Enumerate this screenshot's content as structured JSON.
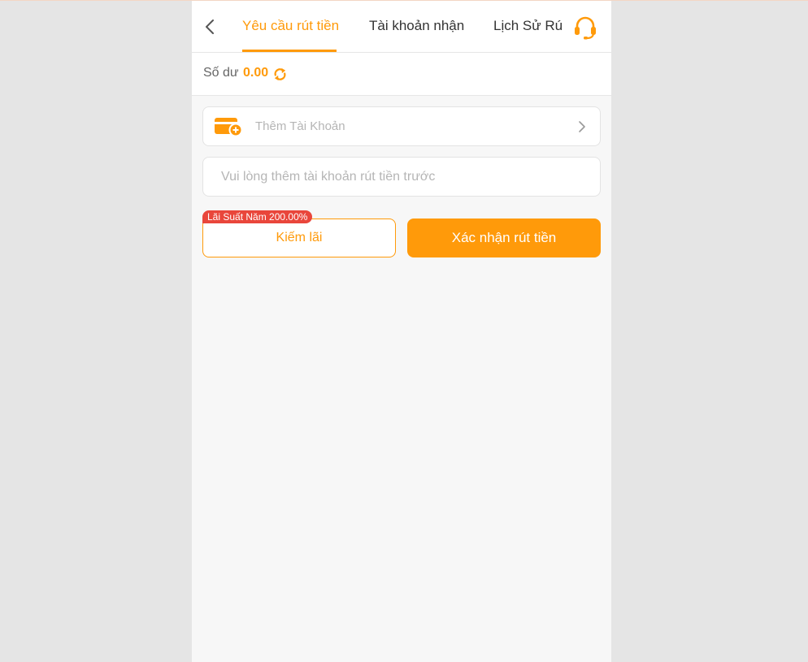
{
  "header": {
    "tabs": [
      {
        "label": "Yêu cầu rút tiền",
        "active": true
      },
      {
        "label": "Tài khoản nhận",
        "active": false
      },
      {
        "label": "Lịch Sử Rút Tiền",
        "active": false
      }
    ]
  },
  "balance": {
    "label": "Số dư",
    "value": "0.00"
  },
  "account": {
    "add_label": "Thêm Tài Khoản"
  },
  "notice": {
    "text": "Vui lòng thêm tài khoản rút tiền trước"
  },
  "actions": {
    "rate_badge": "Lãi Suất Năm 200.00%",
    "earn_label": "Kiếm lãi",
    "confirm_label": "Xác nhận rút tiền"
  },
  "colors": {
    "accent": "#ff9a0a",
    "badge": "#e9463b",
    "placeholder": "#b5b5b5"
  },
  "icons": {
    "back": "chevron-left-icon",
    "support": "headset-icon",
    "refresh": "refresh-icon",
    "wallet": "wallet-add-icon",
    "chevron": "chevron-right-icon"
  }
}
